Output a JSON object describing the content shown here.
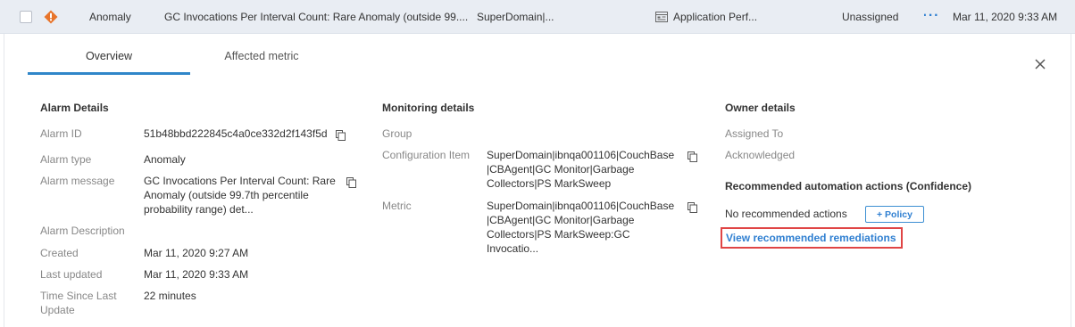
{
  "alarm_row": {
    "type": "Anomaly",
    "message": "GC Invocations Per Interval Count: Rare Anomaly (outside 99....",
    "domain": "SuperDomain|...",
    "application": "Application Perf...",
    "owner": "Unassigned",
    "more_icon": "more-horizontal-icon",
    "timestamp": "Mar 11, 2020 9:33 AM",
    "severity_icon": "warning-diamond-icon",
    "severity_color": "#e8742a"
  },
  "tabs": [
    {
      "label": "Overview",
      "active": true
    },
    {
      "label": "Affected metric",
      "active": false
    }
  ],
  "alarm_details": {
    "title": "Alarm Details",
    "alarm_id_label": "Alarm ID",
    "alarm_id": "51b48bbd222845c4a0ce332d2f143f5d",
    "alarm_type_label": "Alarm type",
    "alarm_type": "Anomaly",
    "alarm_message_label": "Alarm message",
    "alarm_message_lines": [
      "GC Invocations Per Interval Count: Rare",
      "Anomaly (outside 99.7th percentile",
      "probability range) det..."
    ],
    "alarm_description_label": "Alarm Description",
    "created_label": "Created",
    "created": "Mar 11, 2020 9:27 AM",
    "last_updated_label": "Last updated",
    "last_updated": "Mar 11, 2020 9:33 AM",
    "time_since_label_lines": [
      "Time Since Last",
      "Update"
    ],
    "time_since": "22 minutes"
  },
  "monitoring_details": {
    "title": "Monitoring details",
    "group_label": "Group",
    "config_item_label": "Configuration Item",
    "config_item_lines": [
      "SuperDomain|ibnqa001106|CouchBase",
      "|CBAgent|GC Monitor|Garbage",
      "Collectors|PS MarkSweep"
    ],
    "metric_label": "Metric",
    "metric_lines": [
      "SuperDomain|ibnqa001106|CouchBase",
      "|CBAgent|GC Monitor|Garbage",
      "Collectors|PS MarkSweep:GC",
      "Invocatio..."
    ]
  },
  "owner_details": {
    "title": "Owner details",
    "assigned_to_label": "Assigned To",
    "acknowledged_label": "Acknowledged",
    "recommended_title": "Recommended automation actions (Confidence)",
    "no_actions": "No recommended actions",
    "policy_button": "+ Policy",
    "remediations_link": "View recommended remediations"
  },
  "colors": {
    "accent": "#2f7fd1",
    "highlight_box": "#e04545",
    "row_bg": "#e9edf3"
  }
}
